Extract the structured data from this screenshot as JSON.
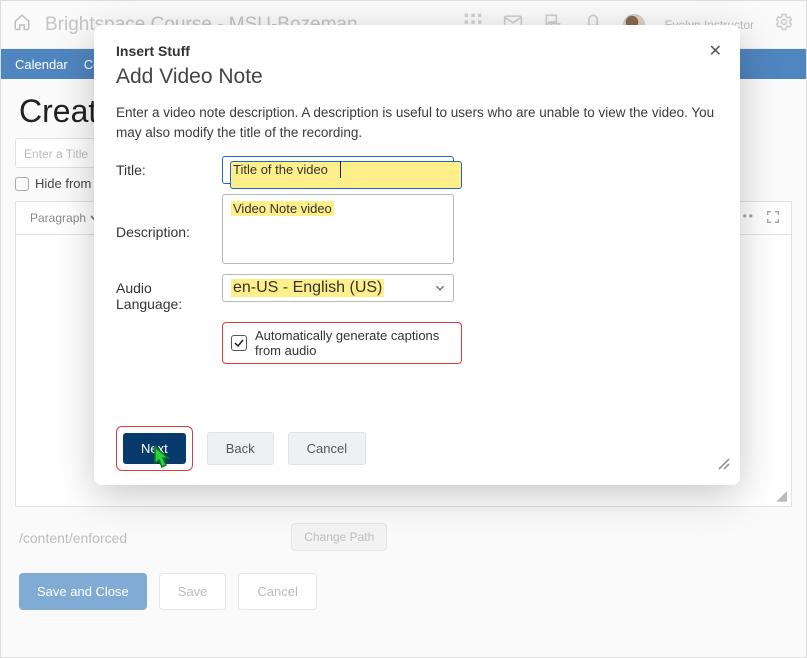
{
  "topnav": {
    "brand": "Brightspace Course - MSU-Bozeman",
    "user": "Evelyn Instructor"
  },
  "subnav": {
    "item1": "Calendar",
    "item2": "Co"
  },
  "page": {
    "title_truncated": "Create",
    "title_placeholder": "Enter a Title",
    "hide_label": "Hide from U",
    "toolbar_par": "Paragraph",
    "path_prefix": "/content/enforced",
    "change_path": "Change Path",
    "save_close": "Save and Close",
    "save": "Save",
    "cancel": "Cancel"
  },
  "modal": {
    "header": "Insert Stuff",
    "subtitle": "Add Video Note",
    "description": "Enter a video note description. A description is useful to users who are unable to view the video. You may also modify the title of the recording.",
    "labels": {
      "title": "Title:",
      "description": "Description:",
      "audio_lang": "Audio Language:"
    },
    "fields": {
      "title_value": "Title of the video",
      "description_value": "Video Note video",
      "audio_lang_value": "en-US - English (US)",
      "auto_caption_label": "Automatically generate captions from audio",
      "auto_caption_checked": true
    },
    "buttons": {
      "next": "Next",
      "back": "Back",
      "cancel": "Cancel"
    }
  }
}
